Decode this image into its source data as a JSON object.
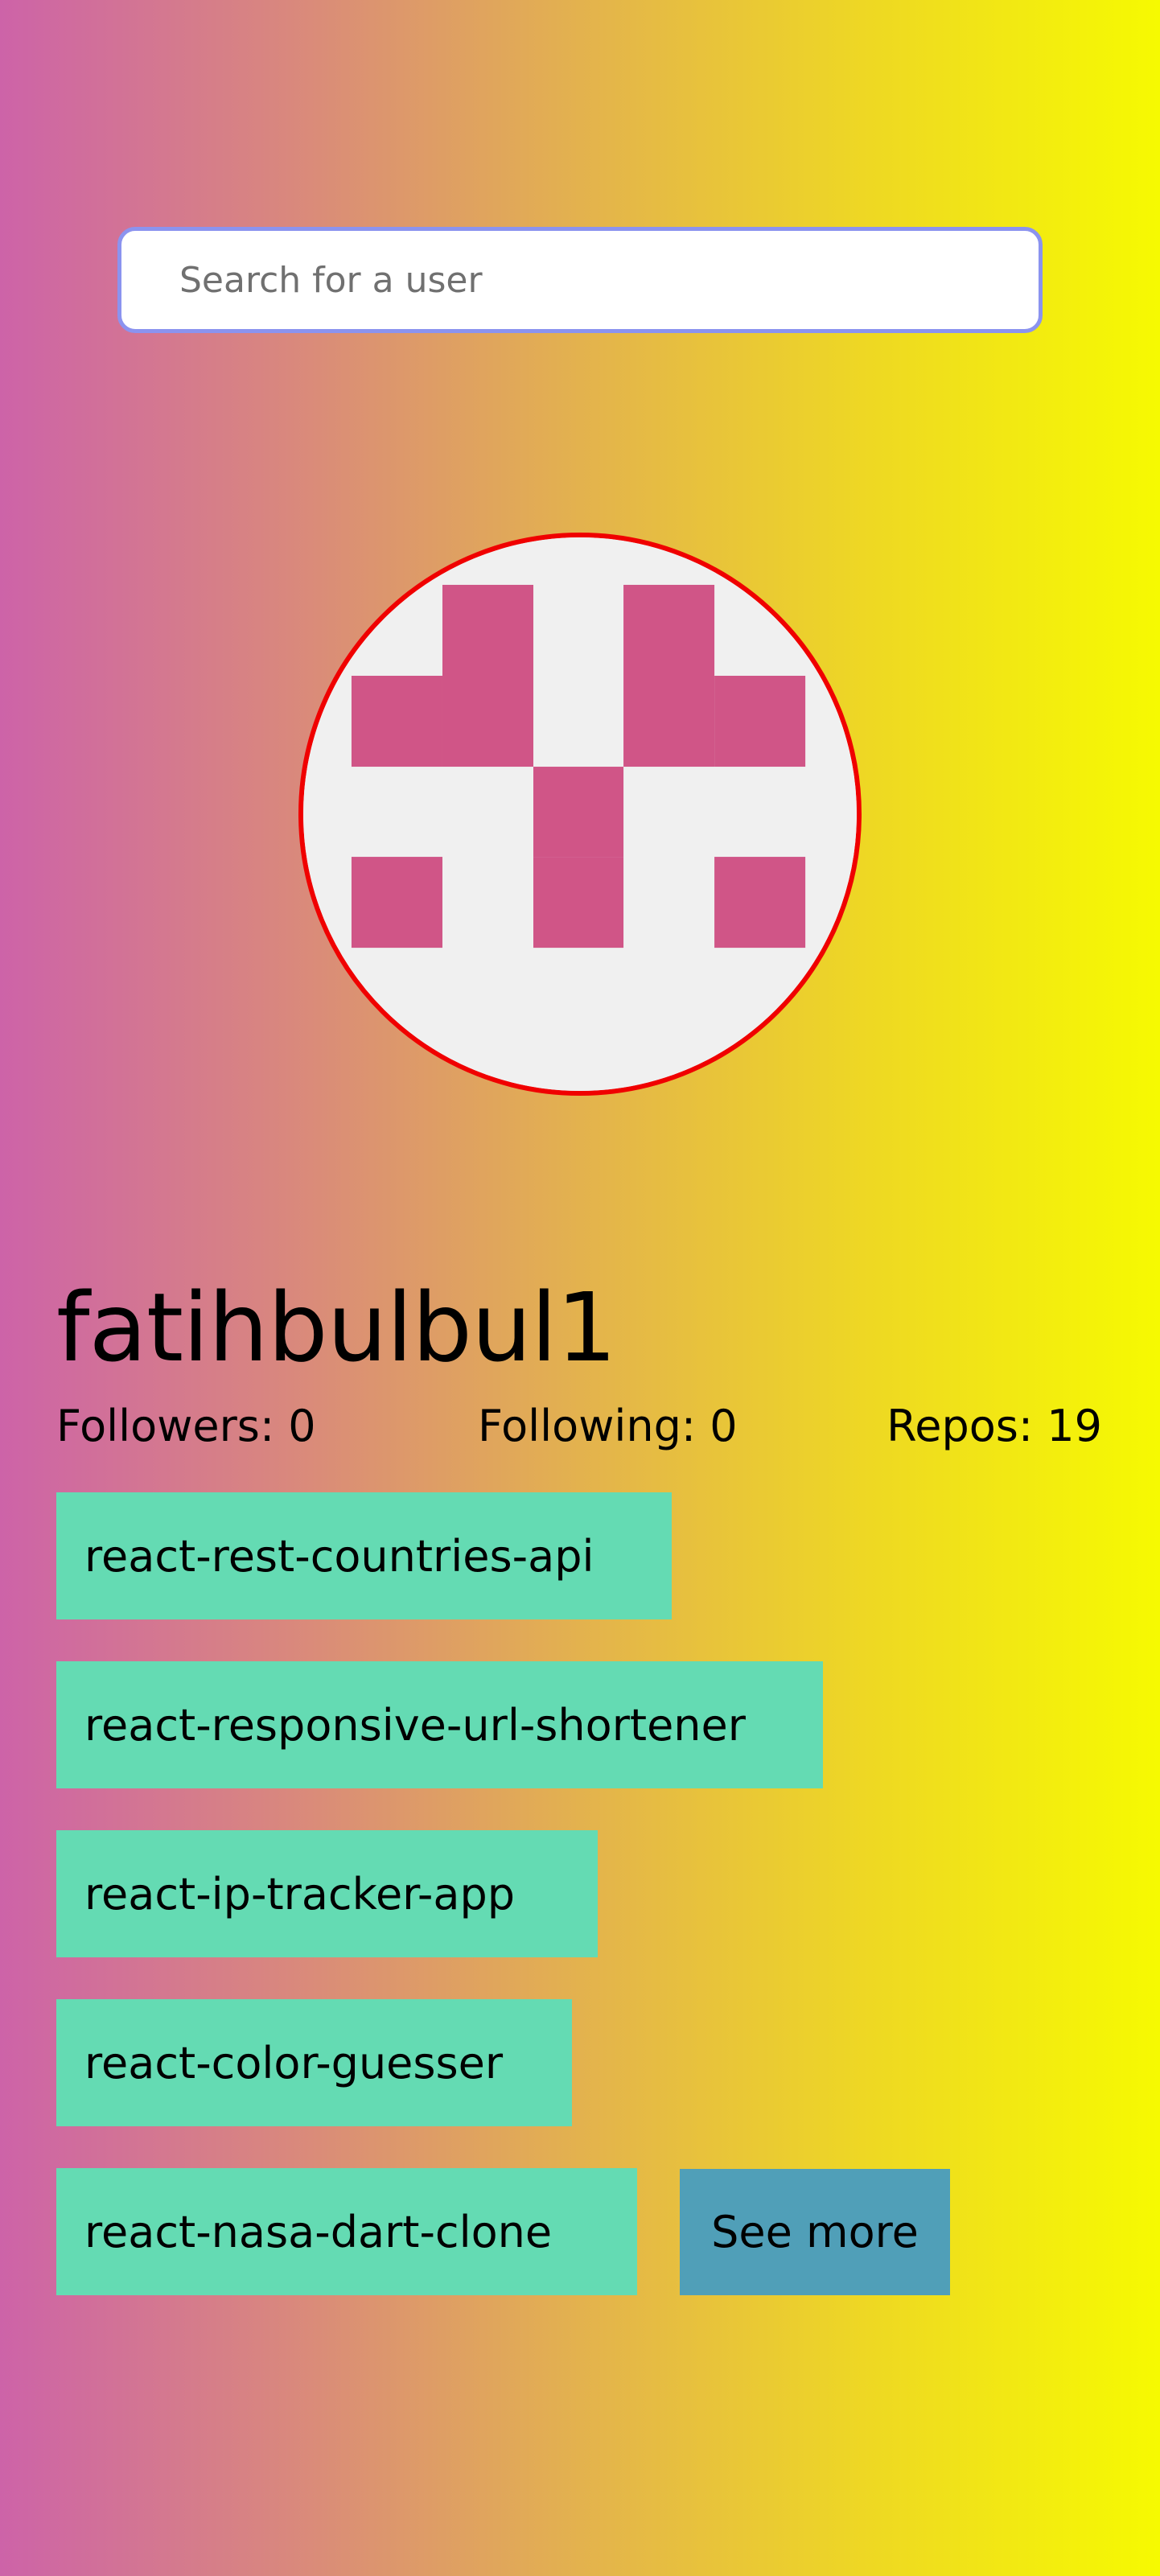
{
  "search": {
    "placeholder": "Search for a user",
    "value": ""
  },
  "profile": {
    "avatar_colors": {
      "background": "#f0f0f0",
      "foreground": "#d05587",
      "border": "#f00000"
    },
    "username": "fatihbulbul1",
    "followers": "Followers: 0",
    "following": "Following: 0",
    "repos": "Repos: 19"
  },
  "repos": [
    {
      "label": "react-rest-countries-api"
    },
    {
      "label": "react-responsive-url-shortener"
    },
    {
      "label": "react-ip-tracker-app"
    },
    {
      "label": "react-color-guesser"
    },
    {
      "label": "react-nasa-dart-clone"
    }
  ],
  "see_more": {
    "label": "See more"
  },
  "colors": {
    "repo_button": "#64dbb3",
    "see_more_button": "#509fb8",
    "search_border": "#8b93ef"
  }
}
